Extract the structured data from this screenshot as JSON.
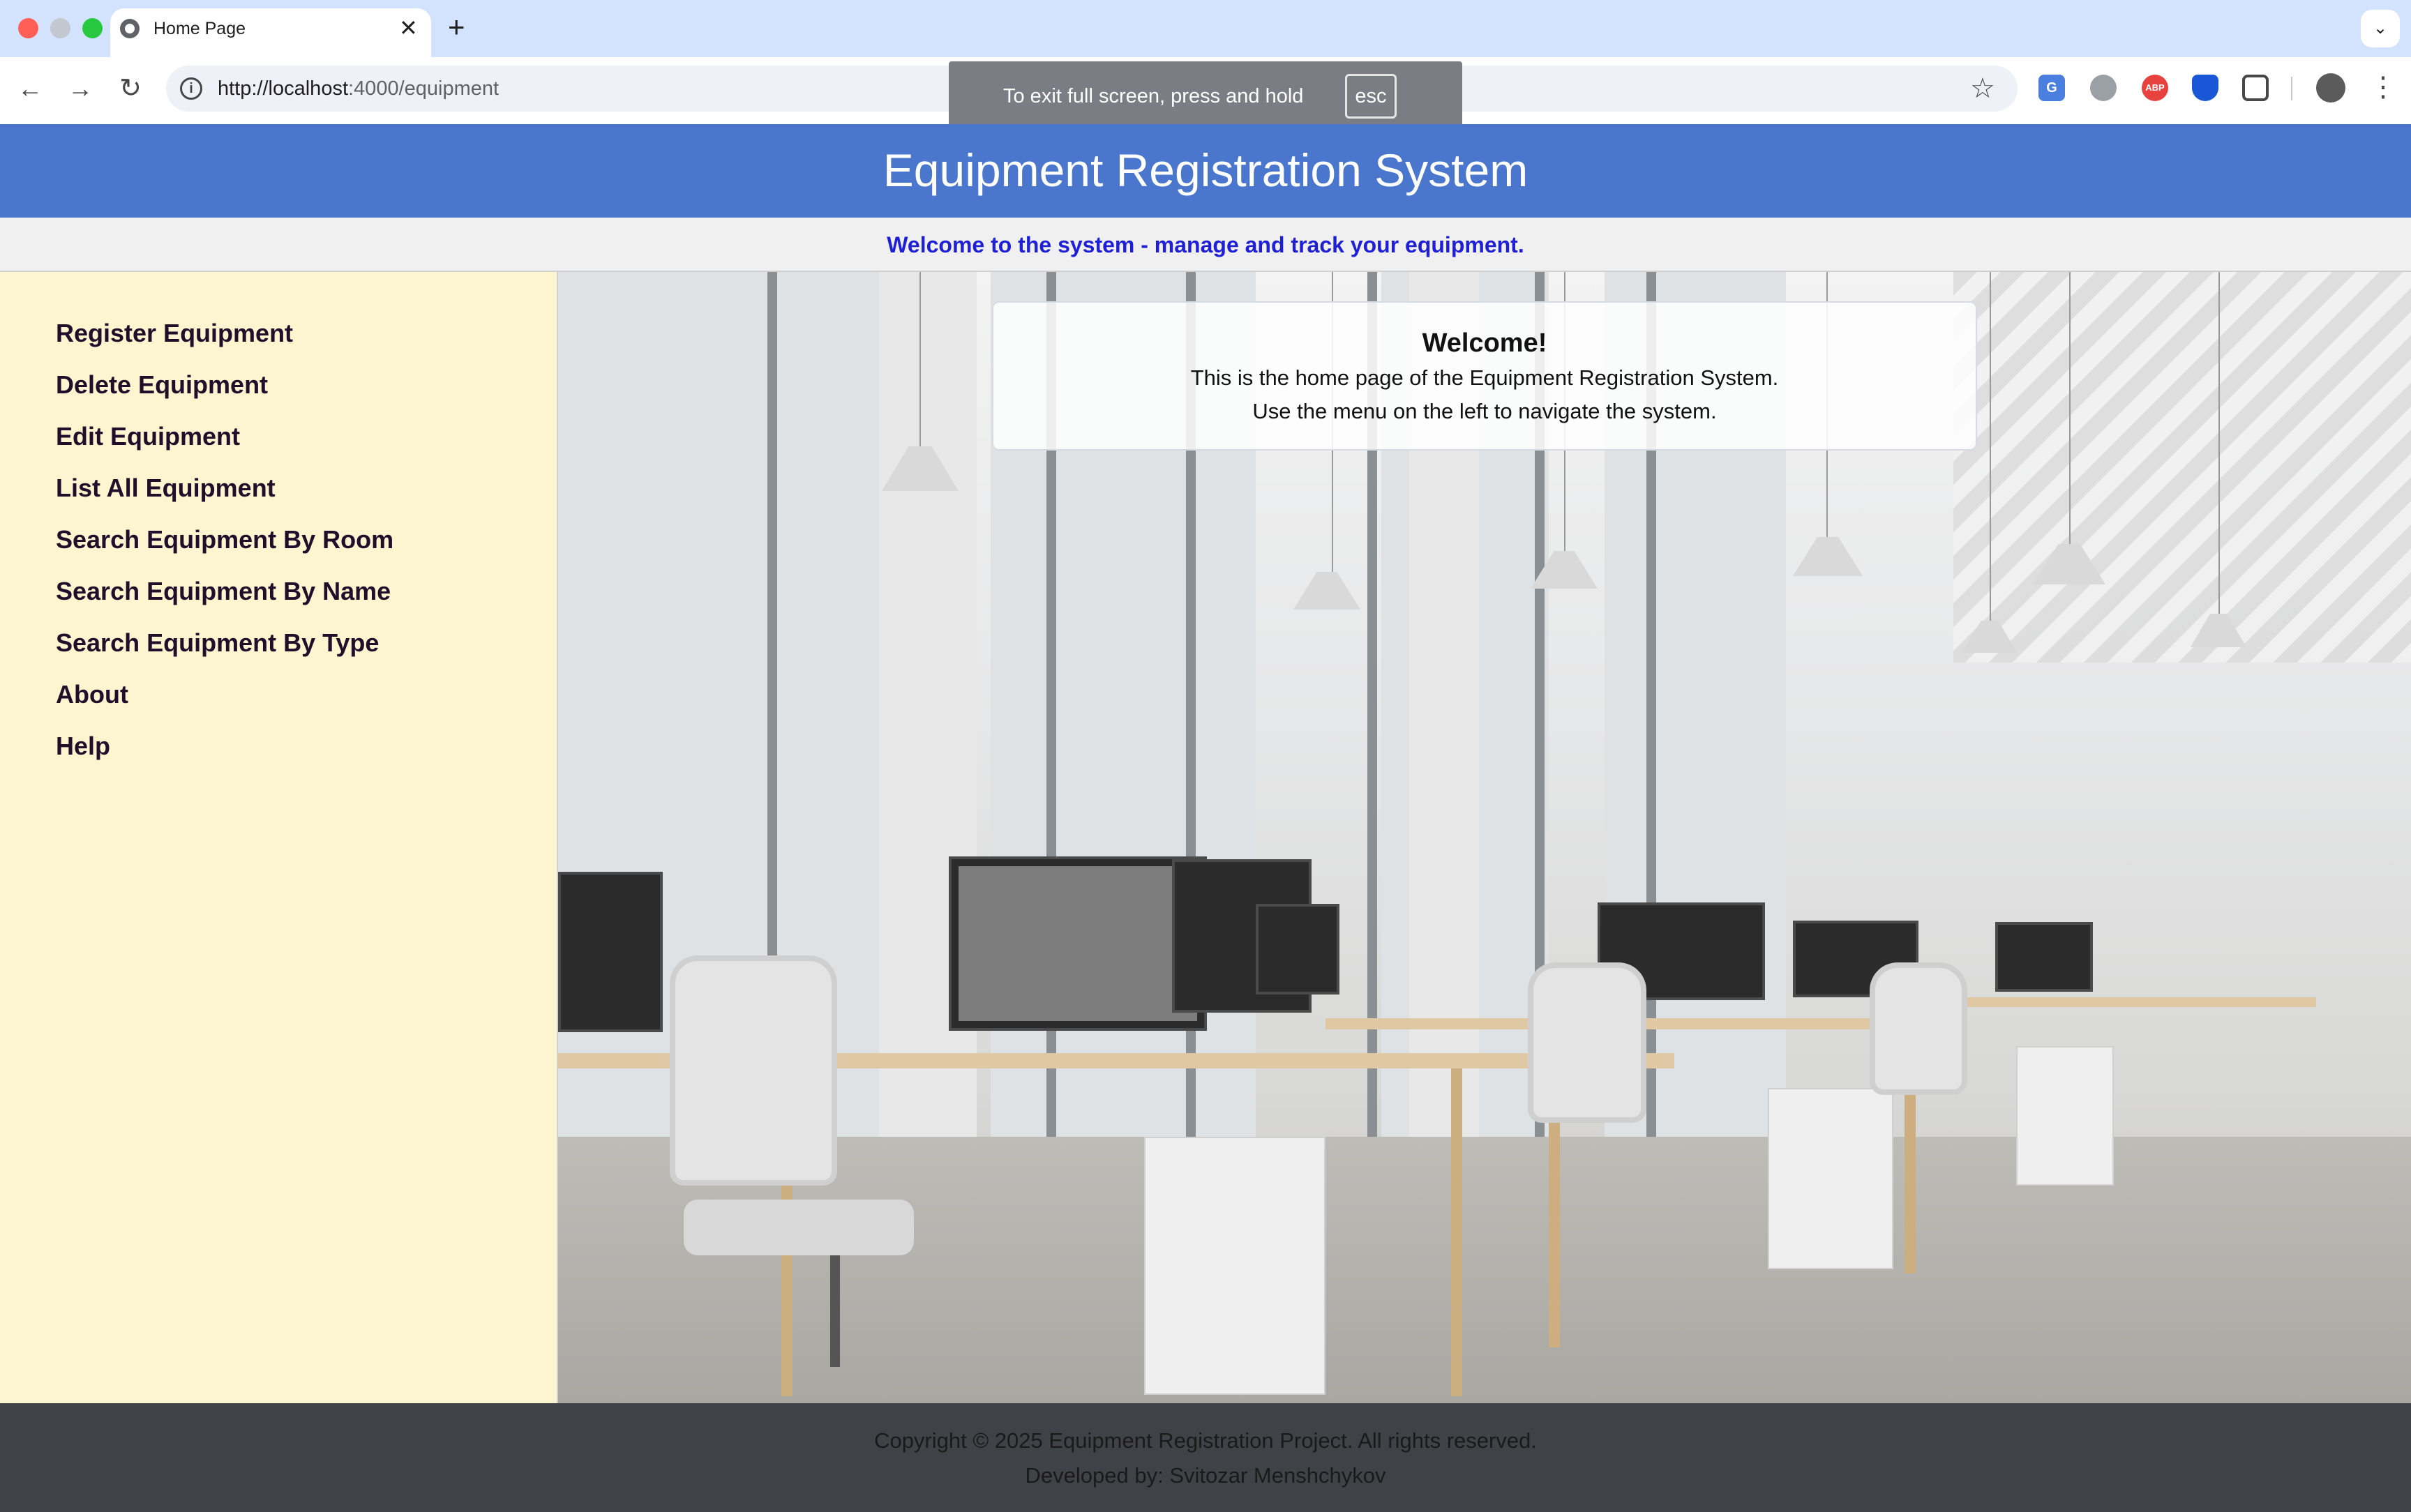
{
  "browser": {
    "tab_title": "Home Page",
    "url_host": "http://localhost",
    "url_rest": ":4000/equipment",
    "fullscreen_toast": "To exit full screen, press and hold",
    "fullscreen_key": "esc",
    "tab_close_glyph": "✕",
    "new_tab_glyph": "+",
    "back_glyph": "←",
    "forward_glyph": "→",
    "reload_glyph": "↻",
    "info_glyph": "i",
    "star_glyph": "☆",
    "menu_glyph": "⋮",
    "tab_search_glyph": "⌄",
    "extensions": [
      "translate-icon",
      "globe-icon",
      "adblock-icon",
      "shield-icon",
      "puzzle-icon"
    ],
    "abp_label": "ABP",
    "translate_label": "G"
  },
  "header": {
    "title": "Equipment Registration System",
    "subtitle": "Welcome to the system - manage and track your equipment.",
    "color": "#4a77cd",
    "subtitle_color": "#1f1fd6"
  },
  "sidebar": {
    "background": "#fdf5cf",
    "items": [
      {
        "label": "Register Equipment"
      },
      {
        "label": "Delete Equipment"
      },
      {
        "label": "Edit Equipment"
      },
      {
        "label": "List All Equipment"
      },
      {
        "label": "Search Equipment By Room"
      },
      {
        "label": "Search Equipment By Name"
      },
      {
        "label": "Search Equipment By Type"
      },
      {
        "label": "About"
      },
      {
        "label": "Help"
      }
    ]
  },
  "main": {
    "welcome": {
      "title": "Welcome!",
      "line1": "This is the home page of the Equipment Registration System.",
      "line2": "Use the menu on the left to navigate the system."
    }
  },
  "footer": {
    "copyright": "Copyright © 2025 Equipment Registration Project. All rights reserved.",
    "developer": "Developed by: Svitozar Menshchykov",
    "background": "#3f4246"
  }
}
